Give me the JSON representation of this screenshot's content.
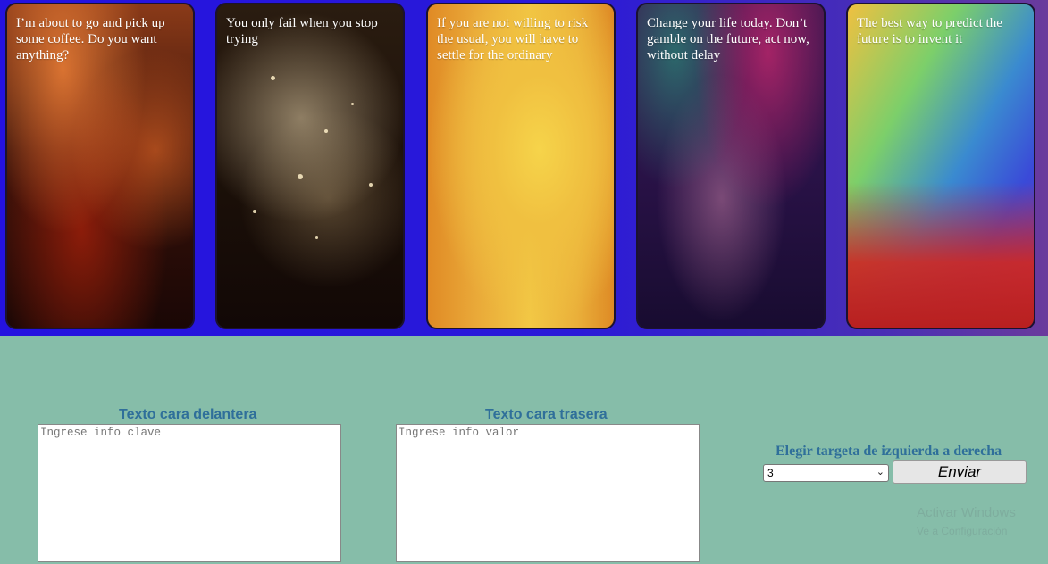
{
  "cards": [
    {
      "text": "I’m about to go and pick up some coffee. Do you want anything?"
    },
    {
      "text": "You only fail when you stop trying"
    },
    {
      "text": "If you are not willing to risk the usual, you will have to settle for the ordinary"
    },
    {
      "text": "Change your life today. Don’t gamble on the future, act now, without delay"
    },
    {
      "text": "The best way to predict the future is to invent it"
    }
  ],
  "form": {
    "front_title": "Texto cara delantera",
    "front_placeholder": "Ingrese info clave",
    "back_title": "Texto cara trasera",
    "back_placeholder": "Ingrese info valor",
    "select_label": "Elegir targeta de izquierda a derecha",
    "select_value": "3",
    "submit_label": "Enviar"
  },
  "watermark": {
    "line1": "Activar Windows",
    "line2": "Ve a Configuración"
  }
}
